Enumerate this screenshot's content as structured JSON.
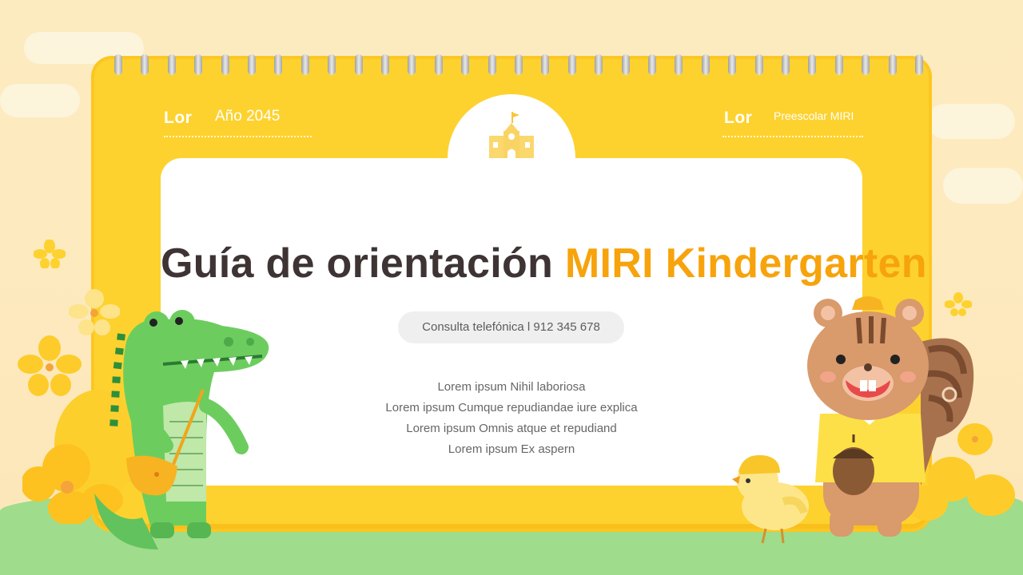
{
  "header": {
    "left_label": "Lor",
    "left_value": "Año 2045",
    "right_label": "Lor",
    "right_value": "Preescolar MIRI"
  },
  "title": {
    "main": "Guía de orientación",
    "highlight": "MIRI Kindergarten"
  },
  "contact": "Consulta telefónica l 912 345 678",
  "lines": [
    "Lorem ipsum Nihil laboriosa",
    "Lorem ipsum Cumque repudiandae iure explica",
    "Lorem ipsum Omnis atque et repudiand",
    "Lorem ipsum Ex aspern"
  ],
  "colors": {
    "calendar": "#fdd22f",
    "accent": "#f7a30c",
    "title": "#3d3433",
    "grass": "#9fdc8c"
  },
  "icons": [
    "school-building-icon",
    "crocodile-illustration",
    "squirrel-illustration",
    "chick-illustration",
    "flower-icon",
    "cloud"
  ]
}
